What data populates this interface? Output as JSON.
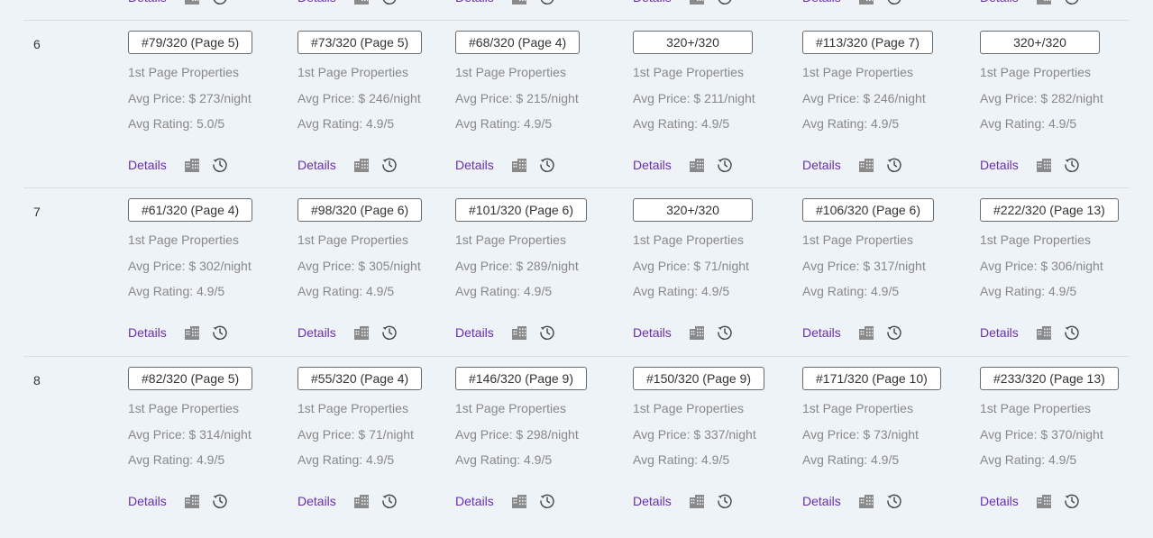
{
  "rows": [
    {
      "number": "6",
      "cells": [
        {
          "rank": "#79/320 (Page 5)",
          "subtitle": "1st Page Properties",
          "price": "Avg Price: $ 273/night",
          "rating": "Avg Rating: 5.0/5",
          "details": "Details"
        },
        {
          "rank": "#73/320 (Page 5)",
          "subtitle": "1st Page Properties",
          "price": "Avg Price: $ 246/night",
          "rating": "Avg Rating: 4.9/5",
          "details": "Details"
        },
        {
          "rank": "#68/320 (Page 4)",
          "subtitle": "1st Page Properties",
          "price": "Avg Price: $ 215/night",
          "rating": "Avg Rating: 4.9/5",
          "details": "Details"
        },
        {
          "rank": "320+/320",
          "subtitle": "1st Page Properties",
          "price": "Avg Price: $ 211/night",
          "rating": "Avg Rating: 4.9/5",
          "details": "Details"
        },
        {
          "rank": "#113/320 (Page 7)",
          "subtitle": "1st Page Properties",
          "price": "Avg Price: $ 246/night",
          "rating": "Avg Rating: 4.9/5",
          "details": "Details"
        },
        {
          "rank": "320+/320",
          "subtitle": "1st Page Properties",
          "price": "Avg Price: $ 282/night",
          "rating": "Avg Rating: 4.9/5",
          "details": "Details"
        }
      ]
    },
    {
      "number": "7",
      "cells": [
        {
          "rank": "#61/320 (Page 4)",
          "subtitle": "1st Page Properties",
          "price": "Avg Price: $ 302/night",
          "rating": "Avg Rating: 4.9/5",
          "details": "Details"
        },
        {
          "rank": "#98/320 (Page 6)",
          "subtitle": "1st Page Properties",
          "price": "Avg Price: $ 305/night",
          "rating": "Avg Rating: 4.9/5",
          "details": "Details"
        },
        {
          "rank": "#101/320 (Page 6)",
          "subtitle": "1st Page Properties",
          "price": "Avg Price: $ 289/night",
          "rating": "Avg Rating: 4.9/5",
          "details": "Details"
        },
        {
          "rank": "320+/320",
          "subtitle": "1st Page Properties",
          "price": "Avg Price: $ 71/night",
          "rating": "Avg Rating: 4.9/5",
          "details": "Details"
        },
        {
          "rank": "#106/320 (Page 6)",
          "subtitle": "1st Page Properties",
          "price": "Avg Price: $ 317/night",
          "rating": "Avg Rating: 4.9/5",
          "details": "Details"
        },
        {
          "rank": "#222/320 (Page 13)",
          "subtitle": "1st Page Properties",
          "price": "Avg Price: $ 306/night",
          "rating": "Avg Rating: 4.9/5",
          "details": "Details"
        }
      ]
    },
    {
      "number": "8",
      "cells": [
        {
          "rank": "#82/320 (Page 5)",
          "subtitle": "1st Page Properties",
          "price": "Avg Price: $ 314/night",
          "rating": "Avg Rating: 4.9/5",
          "details": "Details"
        },
        {
          "rank": "#55/320 (Page 4)",
          "subtitle": "1st Page Properties",
          "price": "Avg Price: $ 71/night",
          "rating": "Avg Rating: 4.9/5",
          "details": "Details"
        },
        {
          "rank": "#146/320 (Page 9)",
          "subtitle": "1st Page Properties",
          "price": "Avg Price: $ 298/night",
          "rating": "Avg Rating: 4.9/5",
          "details": "Details"
        },
        {
          "rank": "#150/320 (Page 9)",
          "subtitle": "1st Page Properties",
          "price": "Avg Price: $ 337/night",
          "rating": "Avg Rating: 4.9/5",
          "details": "Details"
        },
        {
          "rank": "#171/320 (Page 10)",
          "subtitle": "1st Page Properties",
          "price": "Avg Price: $ 73/night",
          "rating": "Avg Rating: 4.9/5",
          "details": "Details"
        },
        {
          "rank": "#233/320 (Page 13)",
          "subtitle": "1st Page Properties",
          "price": "Avg Price: $ 370/night",
          "rating": "Avg Rating: 4.9/5",
          "details": "Details"
        }
      ]
    }
  ],
  "icons": {
    "building": "building-icon",
    "history": "history-icon"
  },
  "colors": {
    "link": "#6a2db0",
    "background": "#eef3f8",
    "muted_text": "#888888",
    "icon": "#8a8a8a"
  }
}
